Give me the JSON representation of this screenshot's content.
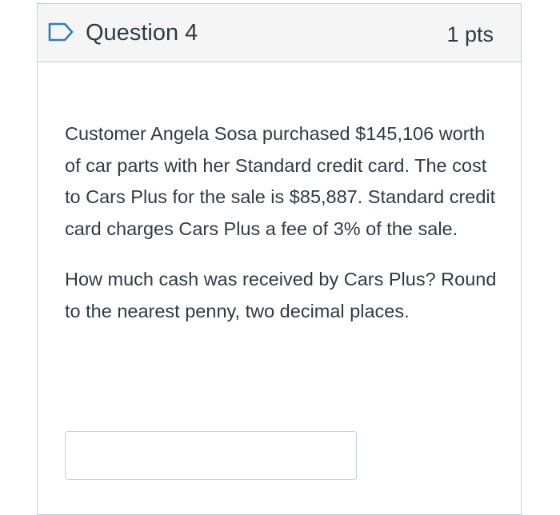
{
  "question": {
    "title": "Question 4",
    "points": "1 pts",
    "flag_icon": "flag-outline-icon",
    "paragraphs": [
      "Customer Angela Sosa purchased $145,106 worth of car parts with her Standard credit card. The cost to Cars Plus for the sale is $85,887. Standard credit card charges Cars Plus a fee of 3% of the sale.",
      "How much cash was received by Cars Plus? Round to the nearest penny, two decimal places."
    ],
    "answer": {
      "value": "",
      "placeholder": ""
    }
  },
  "colors": {
    "flag": "#2d7cc4",
    "header_bg": "#f5f5f5",
    "border": "#c7cdd1",
    "text": "#2d3b45"
  }
}
